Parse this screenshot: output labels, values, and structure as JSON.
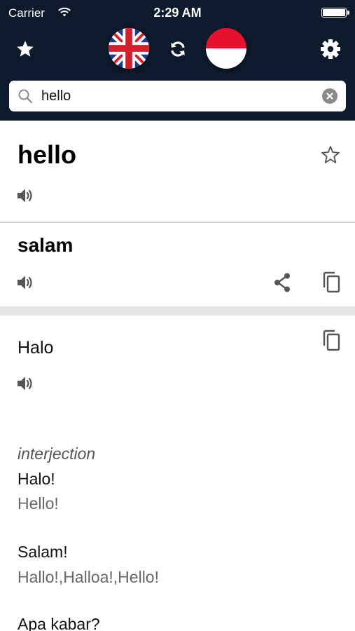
{
  "status_bar": {
    "carrier": "Carrier",
    "time": "2:29 AM"
  },
  "nav": {
    "favorites_icon": "star-icon",
    "source_lang_flag": "uk-flag-icon",
    "swap_icon": "refresh-icon",
    "target_lang_flag": "indonesia-flag-icon",
    "settings_icon": "gear-icon"
  },
  "search": {
    "value": "hello",
    "placeholder": ""
  },
  "entry": {
    "word": "hello",
    "translation": "salam",
    "alternative": "Halo",
    "part_of_speech": "interjection",
    "definitions": [
      {
        "text": "Halo!",
        "meaning": "Hello!"
      },
      {
        "text": "Salam!",
        "meaning": "Hallo!,Halloa!,Hello!"
      },
      {
        "text": "Apa kabar?"
      }
    ]
  },
  "colors": {
    "header_bg": "#0c1a2b",
    "divider": "#d4d4d4",
    "band": "#e6e6e6"
  }
}
